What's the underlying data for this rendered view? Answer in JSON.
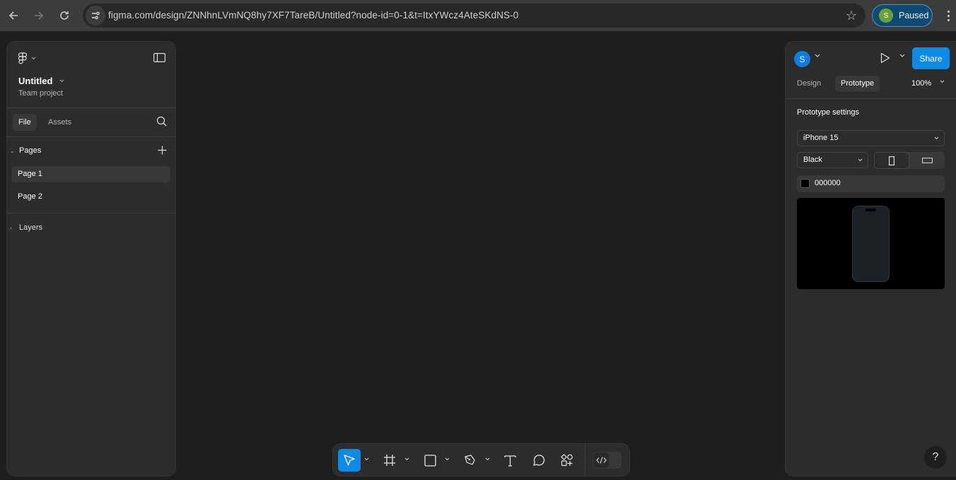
{
  "browser": {
    "url": "figma.com/design/ZNNhnLVmNQ8hy7XF7TareB/Untitled?node-id=0-1&t=ItxYWcz4AteSKdNS-0",
    "profile_initial": "S",
    "profile_status": "Paused",
    "colors": {
      "profile_bg": "#0f4a75",
      "profile_avatar": "#6aa137"
    }
  },
  "left_panel": {
    "file_name": "Untitled",
    "project": "Team project",
    "tabs": [
      {
        "label": "File",
        "active": true
      },
      {
        "label": "Assets",
        "active": false
      }
    ],
    "pages_header": "Pages",
    "pages": [
      {
        "label": "Page 1",
        "selected": true
      },
      {
        "label": "Page 2",
        "selected": false
      }
    ],
    "layers_header": "Layers"
  },
  "right_panel": {
    "user_initial": "S",
    "share_label": "Share",
    "tabs": [
      {
        "label": "Design",
        "active": false
      },
      {
        "label": "Prototype",
        "active": true
      }
    ],
    "zoom": "100%",
    "section_title": "Prototype settings",
    "device": "iPhone 15",
    "device_color": "Black",
    "orientation": "portrait",
    "background_hex": "000000",
    "colors": {
      "accent": "#0d8ae6",
      "avatar": "#0d7ee0"
    }
  },
  "toolbar": {
    "tools": [
      {
        "name": "move",
        "active": true
      },
      {
        "name": "frame",
        "active": false
      },
      {
        "name": "rectangle",
        "active": false
      },
      {
        "name": "pen",
        "active": false
      },
      {
        "name": "text",
        "active": false
      },
      {
        "name": "comment",
        "active": false
      },
      {
        "name": "actions",
        "active": false
      }
    ],
    "dev_mode": false
  },
  "help_label": "?"
}
